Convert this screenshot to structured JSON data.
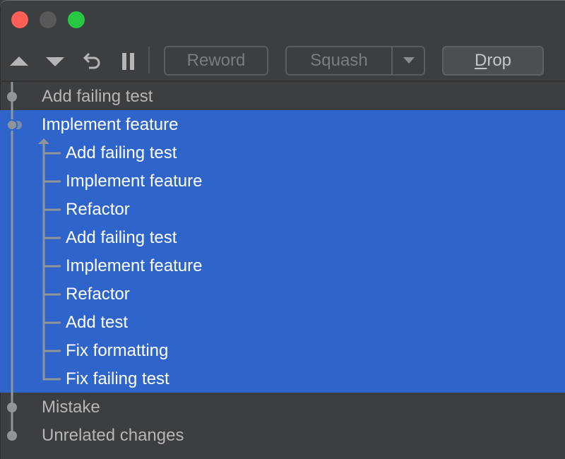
{
  "window": {
    "traffic_lights": [
      {
        "name": "close",
        "color": "#ff5f57"
      },
      {
        "name": "minimize",
        "color": "#58595b"
      },
      {
        "name": "maximize",
        "color": "#28c840"
      }
    ]
  },
  "toolbar": {
    "move_up_icon": "triangle-up-icon",
    "move_down_icon": "triangle-down-icon",
    "undo_icon": "undo-icon",
    "pause_icon": "pause-icon",
    "reword_label": "Reword",
    "squash_label": "Squash",
    "drop_mnemonic": "D",
    "drop_rest": "rop"
  },
  "colors": {
    "background": "#3c3f41",
    "selection": "#2f65ca",
    "graph": "#8e969c",
    "text_normal": "#b4b6b8",
    "text_selected": "#ffffff"
  },
  "commits": [
    {
      "label": "Add failing test",
      "selected": false,
      "children": []
    },
    {
      "label": "Implement feature",
      "selected": true,
      "squashed": true,
      "children": [
        {
          "label": "Add failing test"
        },
        {
          "label": "Implement feature"
        },
        {
          "label": "Refactor"
        },
        {
          "label": "Add failing test"
        },
        {
          "label": "Implement feature"
        },
        {
          "label": "Refactor"
        },
        {
          "label": "Add test"
        },
        {
          "label": "Fix formatting"
        },
        {
          "label": "Fix failing test"
        }
      ]
    },
    {
      "label": "Mistake",
      "selected": false,
      "children": []
    },
    {
      "label": "Unrelated changes",
      "selected": false,
      "children": []
    }
  ]
}
